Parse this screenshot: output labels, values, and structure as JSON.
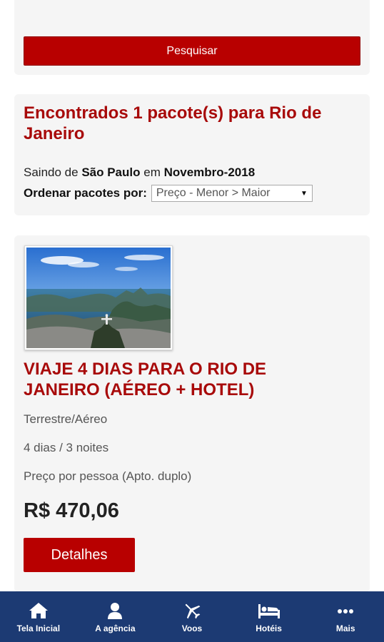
{
  "search": {
    "button_label": "Pesquisar"
  },
  "results": {
    "title": "Encontrados 1 pacote(s) para Rio de Janeiro",
    "leaving_prefix": "Saindo de",
    "origin": "São Paulo",
    "date_prefix": "em",
    "month": "Novembro-2018",
    "sort_label": "Ordenar pacotes por:",
    "sort_value": "Preço - Menor > Maior"
  },
  "package": {
    "title": "VIAJE 4 DIAS PARA O RIO DE JANEIRO (AÉREO + HOTEL)",
    "transport": "Terrestre/Aéreo",
    "duration": "4 dias / 3 noites",
    "price_note": "Preço por pessoa (Apto. duplo)",
    "price": "R$ 470,06",
    "details_label": "Detalhes"
  },
  "nav": {
    "items": [
      {
        "label": "Tela Inicial",
        "icon": "home-icon"
      },
      {
        "label": "A agência",
        "icon": "user-icon"
      },
      {
        "label": "Voos",
        "icon": "plane-icon"
      },
      {
        "label": "Hotéis",
        "icon": "bed-icon"
      },
      {
        "label": "Mais",
        "icon": "more-icon"
      }
    ]
  },
  "colors": {
    "accent_red": "#b80000",
    "title_red": "#a80a0a",
    "nav_blue": "#1c3a73",
    "card_bg": "#f5f5f5"
  }
}
